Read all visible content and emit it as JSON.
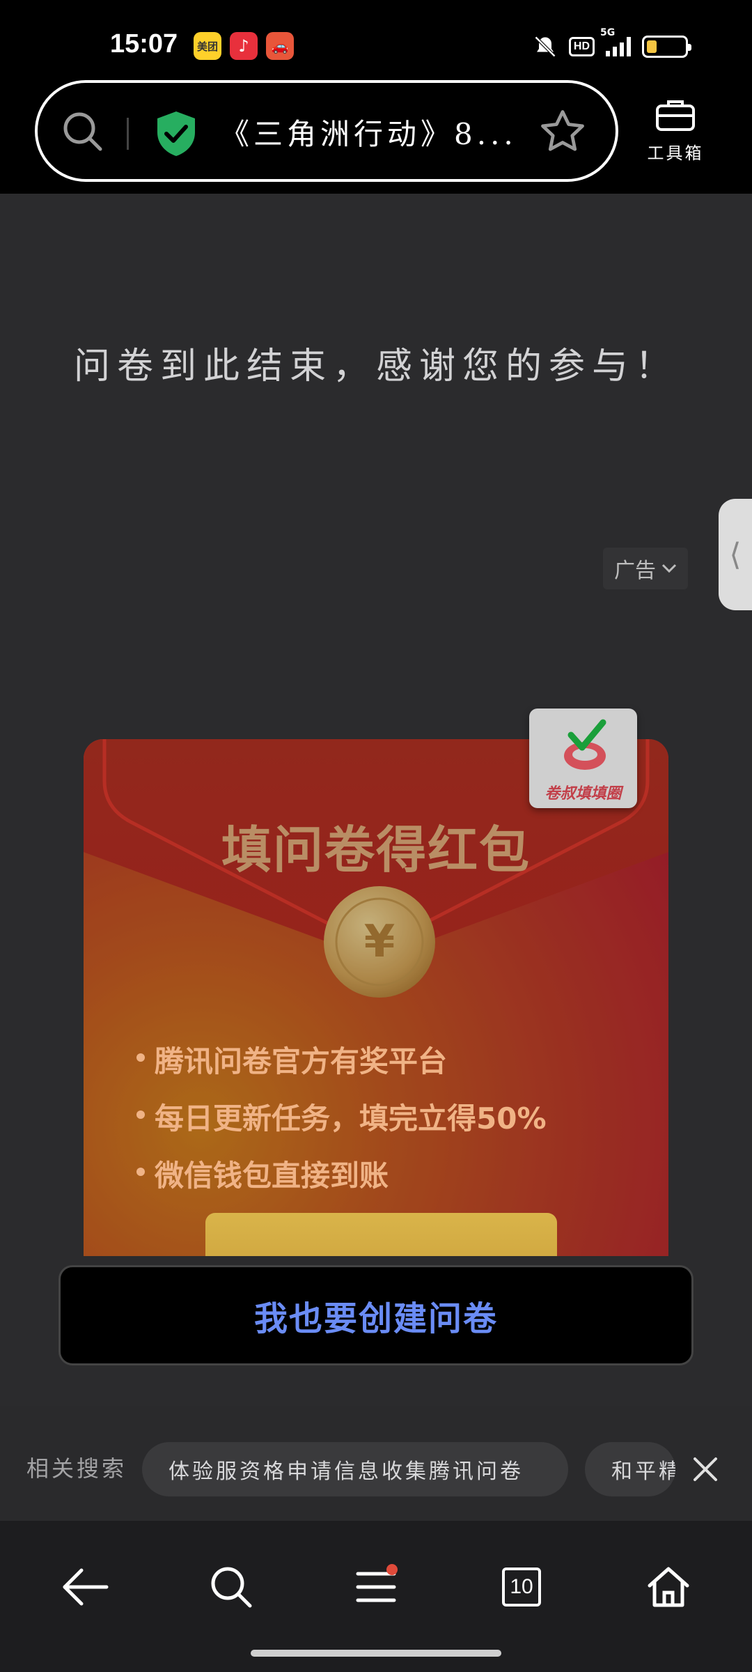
{
  "status_bar": {
    "time": "15:07",
    "apps": [
      "美团",
      "♪",
      "🚗"
    ],
    "network": "5G",
    "hd": "HD",
    "battery_level": 0.25
  },
  "browser": {
    "page_title": "《三角洲行动》8...",
    "toolbox_label": "工具箱"
  },
  "page": {
    "end_message": "问卷到此结束，感谢您的参与！",
    "ad_label": "广告"
  },
  "ad_card": {
    "title": "填问卷得红包",
    "bullets": [
      "腾讯问卷官方有奖平台",
      "每日更新任务，填完立得50%",
      "微信钱包直接到账"
    ],
    "logo_text": "卷叔填填圈"
  },
  "create_button": "我也要创建问卷",
  "related": {
    "label": "相关搜索",
    "chips": [
      "体验服资格申请信息收集腾讯问卷",
      "和平精英"
    ]
  },
  "bottom_nav": {
    "tabs_count": "10"
  },
  "colors": {
    "accent_blue": "#6a8cf5",
    "content_bg": "#2b2b2d",
    "shield_green": "#27ae60"
  }
}
